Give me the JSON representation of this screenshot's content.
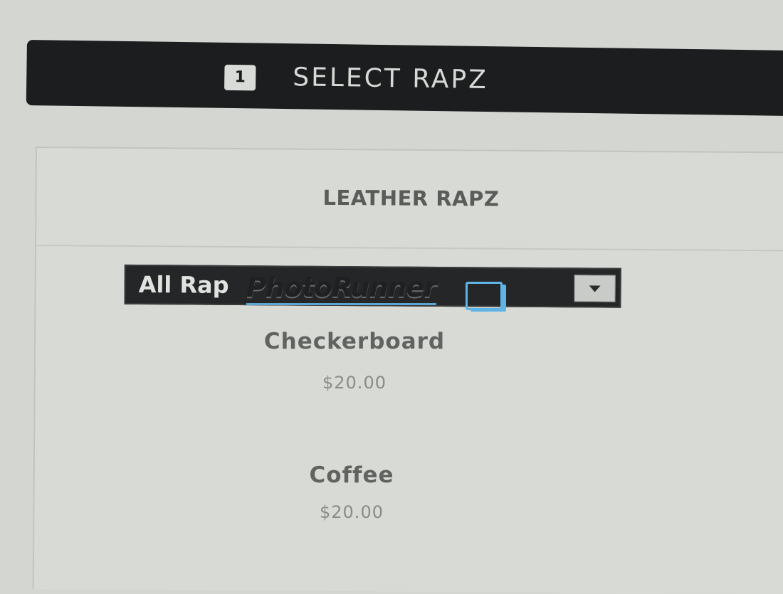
{
  "step": {
    "number": "1",
    "title": "SELECT RAPZ"
  },
  "section": {
    "title": "LEATHER RAPZ"
  },
  "filter": {
    "selected": "All Rap"
  },
  "watermark": {
    "text": "PhotoRunner"
  },
  "products": [
    {
      "name": "Checkerboard",
      "price": "$20.00"
    },
    {
      "name": "Coffee",
      "price": "$20.00"
    }
  ]
}
